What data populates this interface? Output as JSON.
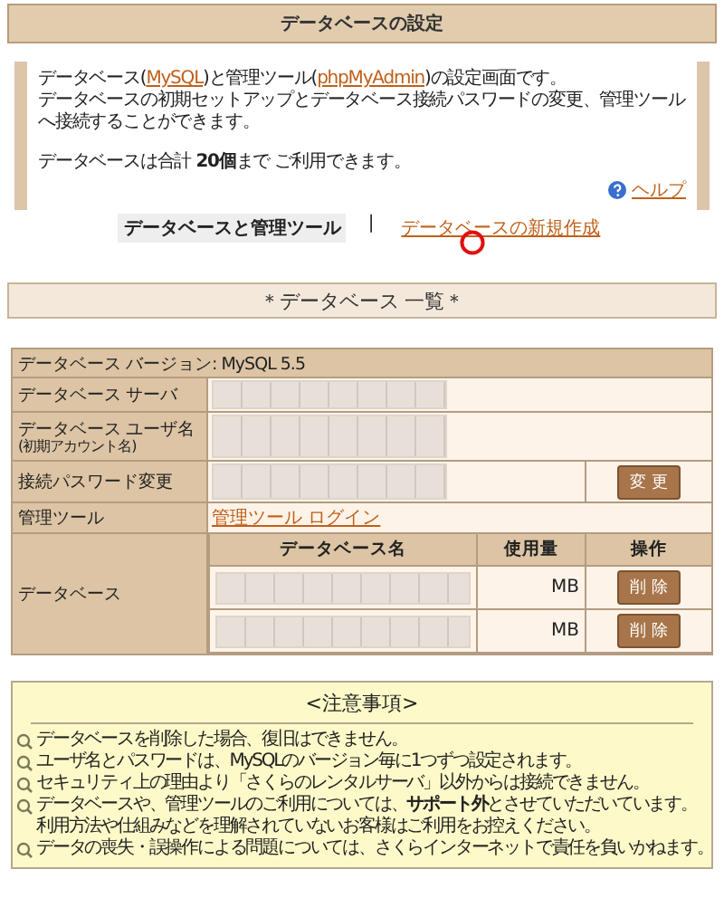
{
  "header": {
    "title": "データベースの設定"
  },
  "intro": {
    "lines": [
      [
        {
          "kind": "text",
          "text": "データベース("
        },
        {
          "kind": "link",
          "text": "MySQL"
        },
        {
          "kind": "text",
          "text": ")と管理ツール("
        },
        {
          "kind": "link",
          "text": "phpMyAdmin"
        },
        {
          "kind": "text",
          "text": ")の設定画面です。"
        }
      ],
      [
        {
          "kind": "text",
          "text": "データベースの初期セットアップとデータベース接続パスワードの変更、管理ツールへ接続することができます。"
        }
      ]
    ],
    "limit": "データベースは合計 **20個**まで ご利用できます。",
    "help": "ヘルプ"
  },
  "tabs": [
    {
      "label": "データベースと管理ツール",
      "selected": true
    },
    {
      "label": "データベースの新規作成",
      "selected": false
    }
  ],
  "tab_separator": "|",
  "list_title": "＊データベース 一覧＊",
  "table": {
    "version": "データベース バージョン: MySQL 5.5",
    "rows": [
      {
        "kind": "masked",
        "label": "データベース サーバ"
      },
      {
        "kind": "masked",
        "label": "データベース ユーザ名",
        "sublabel": "(初期アカウント名)"
      },
      {
        "kind": "button",
        "label": "接続パスワード変更",
        "button": "変 更"
      },
      {
        "kind": "link",
        "label": "管理ツール",
        "link": "管理ツール ログイン"
      }
    ],
    "databases": {
      "label": "データベース",
      "columns": [
        "データベース名",
        "使用量",
        "操作"
      ],
      "rows": [
        {
          "usage": "MB",
          "action": "削 除"
        },
        {
          "usage": "MB",
          "action": "削 除"
        }
      ]
    }
  },
  "notes": {
    "title": "<注意事項>",
    "items": [
      {
        "lines": [
          "データベースを削除した場合、復旧はできません。"
        ]
      },
      {
        "lines": [
          "ユーザ名とパスワードは、MySQLのバージョン毎に1つずつ設定されます。"
        ]
      },
      {
        "lines": [
          "セキュリティ上の理由より「さくらのレンタルサーバ」以外からは接続できません。"
        ]
      },
      {
        "lines": [
          "データベースや、管理ツールのご利用については、**サポート外**とさせていただいています。",
          "利用方法や仕組みなどを理解されていないお客様はご利用をお控えください。"
        ]
      },
      {
        "lines": [
          "データの喪失・誤操作による問題については、さくらインターネットで責任を負いかねます。"
        ]
      }
    ]
  }
}
